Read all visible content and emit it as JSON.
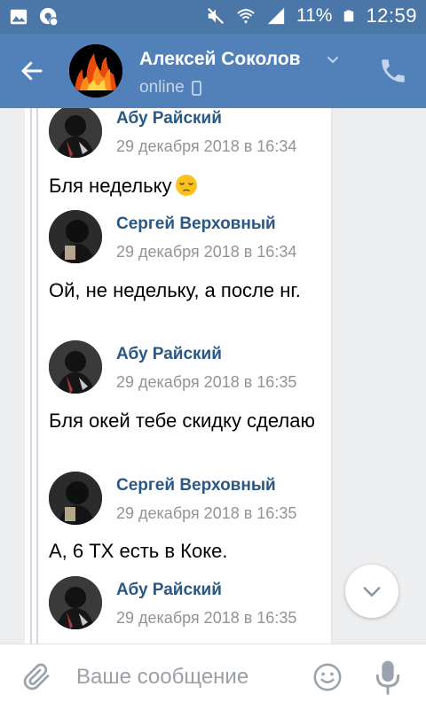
{
  "status_bar": {
    "battery_percent": "11%",
    "time": "12:59",
    "icons": [
      "image-notification-icon",
      "vpn-key-notification-icon",
      "mute-icon",
      "wifi-icon",
      "signal-icon",
      "battery-icon"
    ]
  },
  "header": {
    "title": "Алексей Соколов",
    "status": "online",
    "colors": {
      "accent": "#5181b8",
      "status_bar": "#4a76a8"
    }
  },
  "forwarded": {
    "messages": [
      {
        "author": "Абу Райский",
        "time": "29 декабря 2018 в 16:34",
        "text": "Бля недельку",
        "emoji": "pensive-face"
      },
      {
        "author": "Сергей Верховный",
        "time": "29 декабря 2018 в 16:34",
        "text": "Ой, не недельку, а после нг."
      },
      {
        "author": "Абу Райский",
        "time": "29 декабря 2018 в 16:35",
        "text": "Бля окей тебе скидку сделаю"
      },
      {
        "author": "Сергей Верховный",
        "time": "29 декабря 2018 в 16:35",
        "text": "А, 6 ТХ есть в Коке."
      },
      {
        "author": "Абу Райский",
        "time": "29 декабря 2018 в 16:35",
        "text": ""
      }
    ]
  },
  "composer": {
    "placeholder": "Ваше сообщение",
    "value": ""
  }
}
